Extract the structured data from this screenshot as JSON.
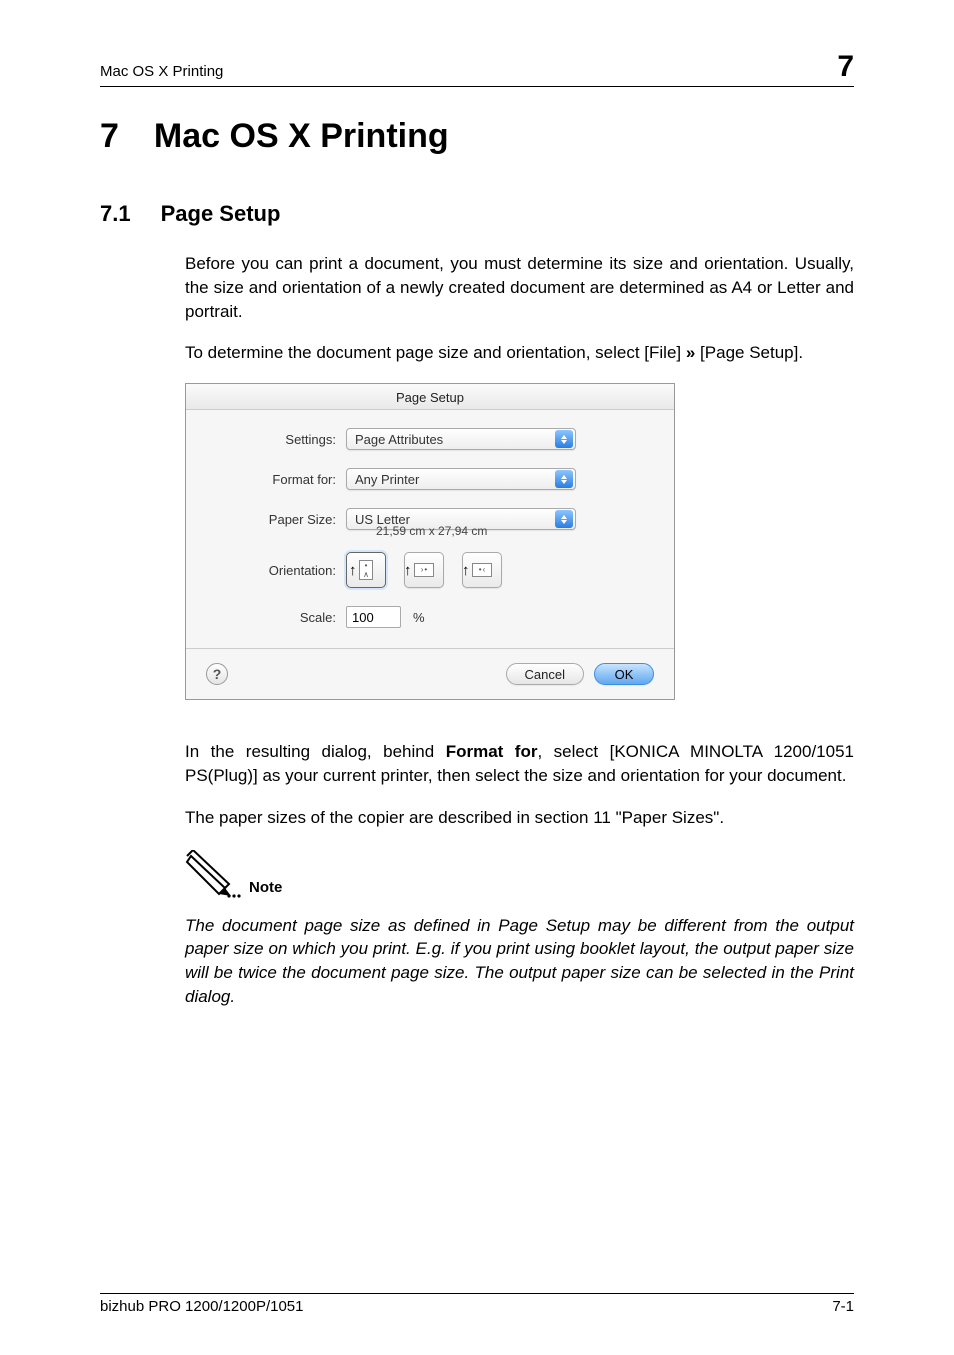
{
  "header": {
    "left": "Mac OS X Printing",
    "right": "7"
  },
  "chapter": {
    "number": "7",
    "title": "Mac OS X Printing"
  },
  "section": {
    "number": "7.1",
    "title": "Page Setup"
  },
  "paragraphs": {
    "p1": "Before you can print a document, you must determine its size and orientation. Usually, the size and orientation of a newly created document are determined as A4 or Letter and portrait.",
    "p2_prefix": "To determine the document page size and orientation, select [File] ",
    "p2_arrow": "»",
    "p2_suffix": " [Page Setup].",
    "p3_prefix": "In the resulting dialog, behind ",
    "p3_bold": "Format for",
    "p3_suffix": ", select [KONICA MINOLTA 1200/1051 PS(Plug)] as your current printer, then select the size and orientation for your document.",
    "p4": "The paper sizes of the copier are described in section 11 \"Paper Sizes\"."
  },
  "dialog": {
    "title": "Page Setup",
    "labels": {
      "settings": "Settings:",
      "format_for": "Format for:",
      "paper_size": "Paper Size:",
      "orientation": "Orientation:",
      "scale": "Scale:"
    },
    "values": {
      "settings": "Page Attributes",
      "format_for": "Any Printer",
      "paper_size": "US Letter",
      "dimensions": "21,59 cm x 27,94 cm",
      "scale": "100",
      "scale_unit": "%"
    },
    "buttons": {
      "help": "?",
      "cancel": "Cancel",
      "ok": "OK"
    }
  },
  "note": {
    "label": "Note",
    "text": "The document page size as defined in Page Setup may be different from the output paper size on which you print. E.g. if you print using booklet layout, the output paper size will be twice the document page size. The output paper size can be selected in the Print dialog."
  },
  "footer": {
    "left": "bizhub PRO 1200/1200P/1051",
    "right": "7-1"
  }
}
